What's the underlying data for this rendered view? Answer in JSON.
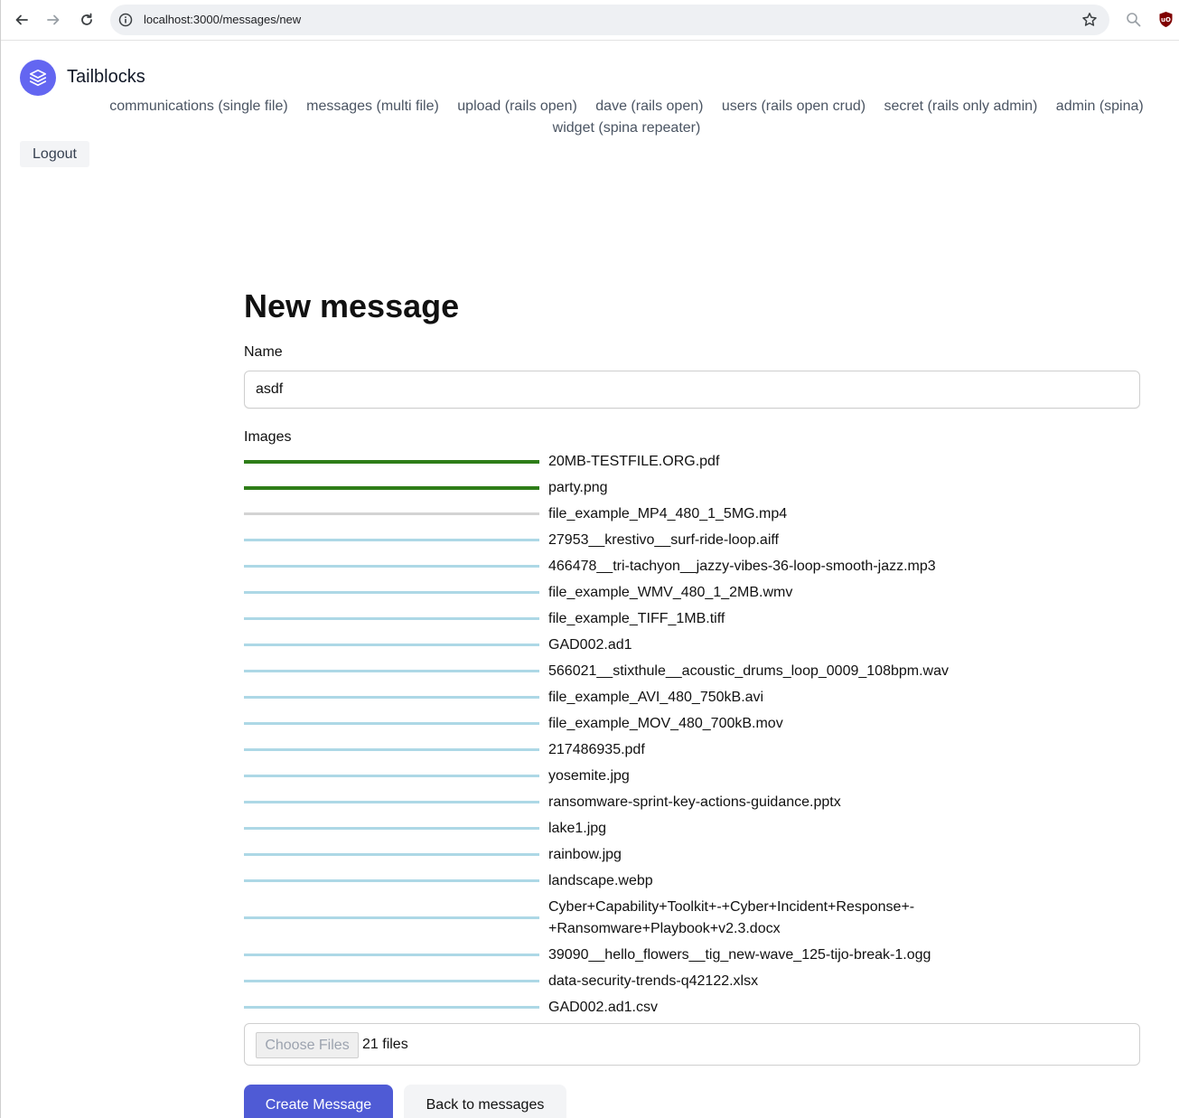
{
  "browser": {
    "url": "localhost:3000/messages/new"
  },
  "app": {
    "brand": "Tailblocks",
    "accent_color": "#6366f1"
  },
  "nav": {
    "items": [
      "communications (single file)",
      "messages (multi file)",
      "upload (rails open)",
      "dave (rails open)",
      "users (rails open crud)",
      "secret (rails only admin)",
      "admin (spina)",
      "widget (spina repeater)"
    ],
    "logout_label": "Logout"
  },
  "form": {
    "title": "New message",
    "name_label": "Name",
    "name_value": "asdf",
    "images_label": "Images",
    "files": [
      {
        "name": "20MB-TESTFILE.ORG.pdf",
        "status": "complete",
        "progress": 1.0
      },
      {
        "name": "party.png",
        "status": "complete",
        "progress": 1.0
      },
      {
        "name": "file_example_MP4_480_1_5MG.mp4",
        "status": "pending",
        "progress": 0
      },
      {
        "name": "27953__krestivo__surf-ride-loop.aiff",
        "status": "queued",
        "progress": 0
      },
      {
        "name": "466478__tri-tachyon__jazzy-vibes-36-loop-smooth-jazz.mp3",
        "status": "queued",
        "progress": 0
      },
      {
        "name": "file_example_WMV_480_1_2MB.wmv",
        "status": "queued",
        "progress": 0
      },
      {
        "name": "file_example_TIFF_1MB.tiff",
        "status": "queued",
        "progress": 0
      },
      {
        "name": "GAD002.ad1",
        "status": "queued",
        "progress": 0
      },
      {
        "name": "566021__stixthule__acoustic_drums_loop_0009_108bpm.wav",
        "status": "queued",
        "progress": 0
      },
      {
        "name": "file_example_AVI_480_750kB.avi",
        "status": "queued",
        "progress": 0
      },
      {
        "name": "file_example_MOV_480_700kB.mov",
        "status": "queued",
        "progress": 0
      },
      {
        "name": "217486935.pdf",
        "status": "queued",
        "progress": 0
      },
      {
        "name": "yosemite.jpg",
        "status": "queued",
        "progress": 0
      },
      {
        "name": "ransomware-sprint-key-actions-guidance.pptx",
        "status": "queued",
        "progress": 0
      },
      {
        "name": "lake1.jpg",
        "status": "queued",
        "progress": 0
      },
      {
        "name": "rainbow.jpg",
        "status": "queued",
        "progress": 0
      },
      {
        "name": "landscape.webp",
        "status": "queued",
        "progress": 0
      },
      {
        "name": "Cyber+Capability+Toolkit+-+Cyber+Incident+Response+-+Ransomware+Playbook+v2.3.docx",
        "status": "queued",
        "progress": 0
      },
      {
        "name": "39090__hello_flowers__tig_new-wave_125-tijo-break-1.ogg",
        "status": "queued",
        "progress": 0
      },
      {
        "name": "data-security-trends-q42122.xlsx",
        "status": "queued",
        "progress": 0
      },
      {
        "name": "GAD002.ad1.csv",
        "status": "queued",
        "progress": 0
      }
    ],
    "choose_files_label": "Choose Files",
    "file_count": "21 files",
    "submit_label": "Create Message",
    "back_label": "Back to messages"
  },
  "colors": {
    "complete": "#2e7d18",
    "pending": "#d3d3d3",
    "queued": "#add8e6",
    "primary_button": "#4f5bd5"
  }
}
